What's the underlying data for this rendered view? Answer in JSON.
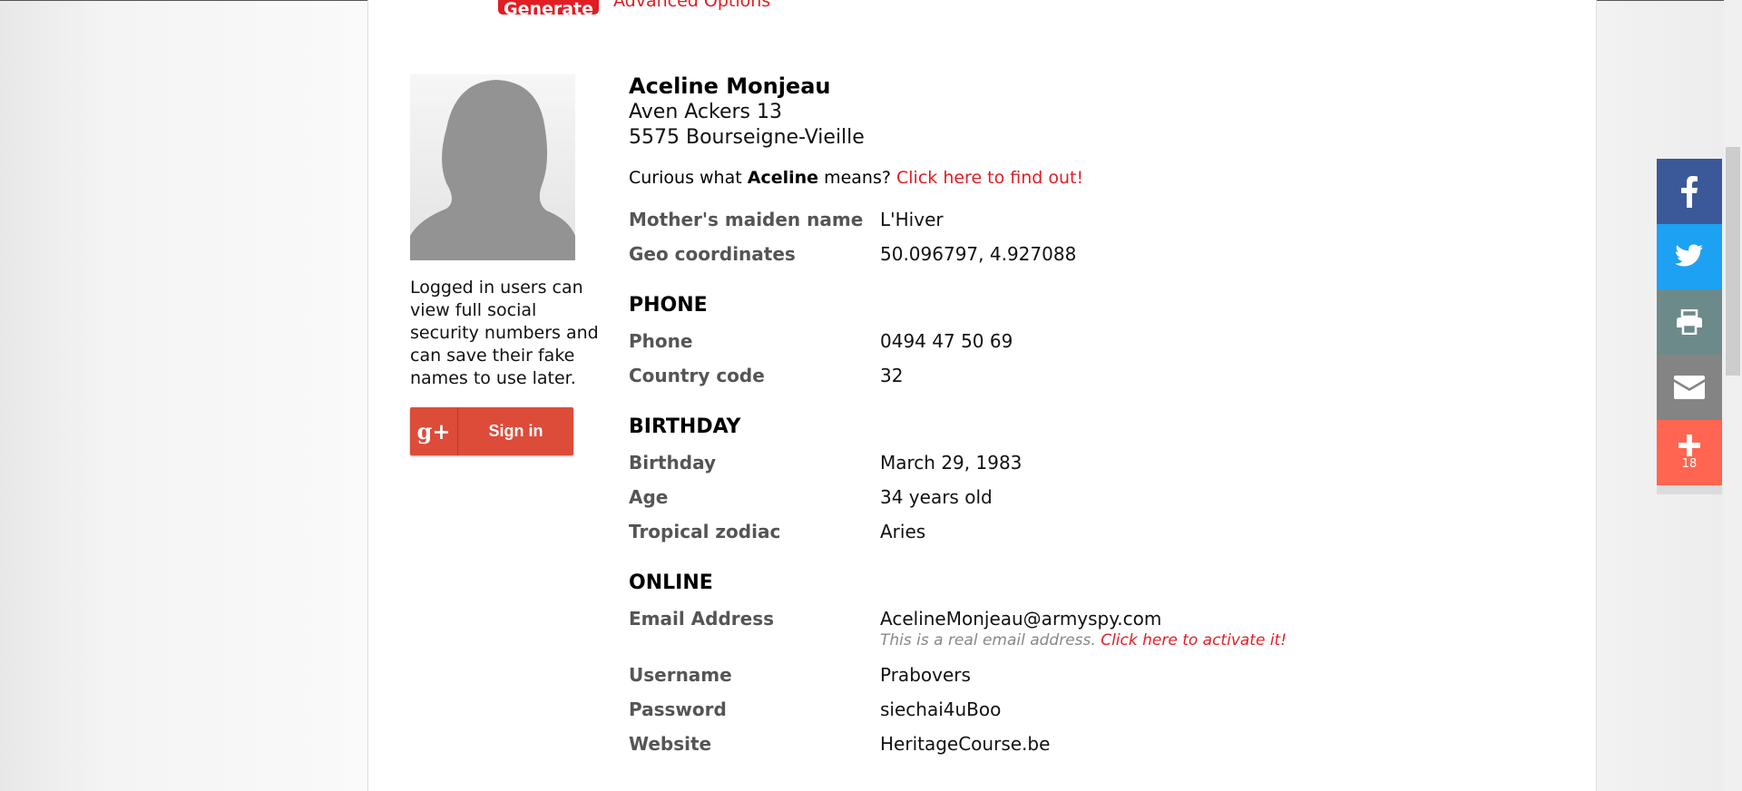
{
  "header": {
    "generate_label": "Generate",
    "advanced_label": "Advanced Options"
  },
  "sidebar": {
    "login_text": "Logged in users can view full social security numbers and can save their fake names to use later.",
    "google_icon_text": "g+",
    "google_label": "Sign in"
  },
  "person": {
    "name": "Aceline Monjeau",
    "address_line1": "Aven Ackers 13",
    "address_line2": "5575 Bourseigne-Vieille",
    "curious_prefix": "Curious what",
    "curious_name": "Aceline",
    "curious_suffix": "means?",
    "curious_link": "Click here to find out!",
    "maiden_label": "Mother's maiden name",
    "maiden_value": "L'Hiver",
    "geo_label": "Geo coordinates",
    "geo_value": "50.096797, 4.927088"
  },
  "phone": {
    "heading": "PHONE",
    "phone_label": "Phone",
    "phone_value": "0494 47 50 69",
    "code_label": "Country code",
    "code_value": "32"
  },
  "birthday": {
    "heading": "BIRTHDAY",
    "birthday_label": "Birthday",
    "birthday_value": "March 29, 1983",
    "age_label": "Age",
    "age_value": "34 years old",
    "zodiac_label": "Tropical zodiac",
    "zodiac_value": "Aries"
  },
  "online": {
    "heading": "ONLINE",
    "email_label": "Email Address",
    "email_value": "AcelineMonjeau@armyspy.com",
    "email_note": "This is a real email address.",
    "email_note_link": "Click here to activate it!",
    "username_label": "Username",
    "username_value": "Prabovers",
    "password_label": "Password",
    "password_value": "siechai4uBoo",
    "website_label": "Website",
    "website_value": "HeritageCourse.be"
  },
  "share": {
    "count": "18",
    "colors": {
      "facebook": "#3b5998",
      "twitter": "#1da1f2",
      "print": "#6d8a8a",
      "email": "#848484",
      "more": "#ff6550"
    }
  },
  "colors": {
    "accent": "#e21d24",
    "label": "#555555"
  }
}
